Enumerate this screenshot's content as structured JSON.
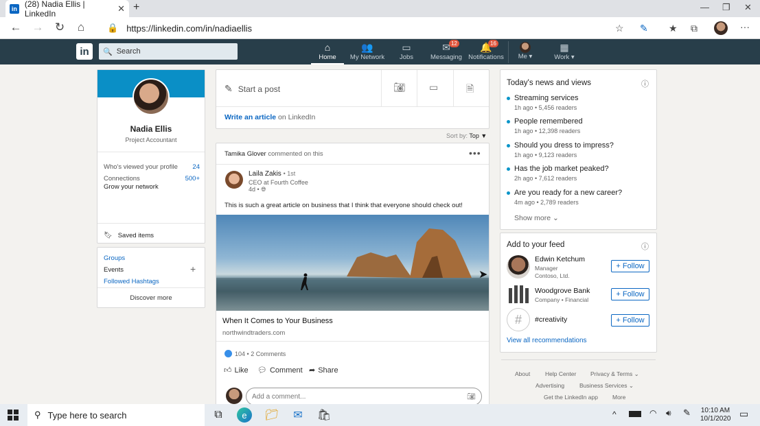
{
  "browser": {
    "tab_title": "(28) Nadia Ellis | LinkedIn",
    "tab_icon": "in",
    "url": "https://linkedin.com/in/nadiaellis"
  },
  "nav": {
    "logo": "in",
    "search_placeholder": "Search",
    "items": [
      {
        "label": "Home",
        "icon": "home-icon",
        "badge": ""
      },
      {
        "label": "My Network",
        "icon": "network-icon",
        "badge": ""
      },
      {
        "label": "Jobs",
        "icon": "briefcase-icon",
        "badge": ""
      },
      {
        "label": "Messaging",
        "icon": "messaging-icon",
        "badge": "12"
      },
      {
        "label": "Notifications",
        "icon": "bell-icon",
        "badge": "16"
      },
      {
        "label": "Me",
        "icon": "avatar-icon",
        "badge": ""
      },
      {
        "label": "Work",
        "icon": "grid-icon",
        "badge": ""
      }
    ]
  },
  "profile": {
    "name": "Nadia Ellis",
    "title": "Project Accountant",
    "viewed_label": "Who's viewed your profile",
    "viewed_count": "24",
    "connections_label": "Connections",
    "connections_count": "500+",
    "grow_label": "Grow your network",
    "saved_label": "Saved items"
  },
  "groups": {
    "groups": "Groups",
    "events": "Events",
    "hashtags": "Followed Hashtags",
    "discover": "Discover more"
  },
  "share": {
    "start_post": "Start a post",
    "write_article": "Write an article",
    "on_linkedin": "on LinkedIn",
    "sort_label": "Sort by:",
    "sort_value": "Top"
  },
  "post": {
    "activity_actor": "Tamika Glover",
    "activity_text": "commented on this",
    "author": "Laila Zakis",
    "degree": "• 1st",
    "headline": "CEO at Fourth Coffee",
    "age": "4d •",
    "text": "This is such a great article on business that I think that everyone should check out!",
    "link_title": "When It Comes to Your Business",
    "link_domain": "northwindtraders.com",
    "reactions": "104",
    "comments": "• 2 Comments",
    "like": "Like",
    "comment": "Comment",
    "share": "Share",
    "comment_placeholder": "Add a comment..."
  },
  "news": {
    "heading": "Today's news and views",
    "items": [
      {
        "title": "Streaming services",
        "meta": "1h ago • 5,456 readers"
      },
      {
        "title": "People remembered",
        "meta": "1h ago • 12,398 readers"
      },
      {
        "title": "Should you dress to impress?",
        "meta": "1h ago • 9,123 readers"
      },
      {
        "title": "Has the job market peaked?",
        "meta": "2h ago • 7,612 readers"
      },
      {
        "title": "Are you ready for a new career?",
        "meta": "4m ago • 2,789 readers"
      }
    ],
    "show_more": "Show more"
  },
  "add_feed": {
    "heading": "Add to your feed",
    "items": [
      {
        "name": "Edwin Ketchum",
        "sub1": "Manager",
        "sub2": "Contoso, Ltd."
      },
      {
        "name": "Woodgrove Bank",
        "sub1": "Company • Financial",
        "sub2": ""
      },
      {
        "name": "#creativity",
        "sub1": "",
        "sub2": ""
      }
    ],
    "follow": "Follow",
    "view_all": "View all recommendations"
  },
  "footer": {
    "about": "About",
    "help": "Help Center",
    "privacy": "Privacy & Terms",
    "advertising": "Advertising",
    "business": "Business Services",
    "app": "Get the LinkedIn app",
    "more": "More"
  },
  "taskbar": {
    "search": "Type here to search",
    "time": "10:10 AM",
    "date": "10/1/2020"
  },
  "colors": {
    "linkedin_nav": "#283e4a",
    "accent": "#0a66c2",
    "banner": "#0a8fc6"
  }
}
